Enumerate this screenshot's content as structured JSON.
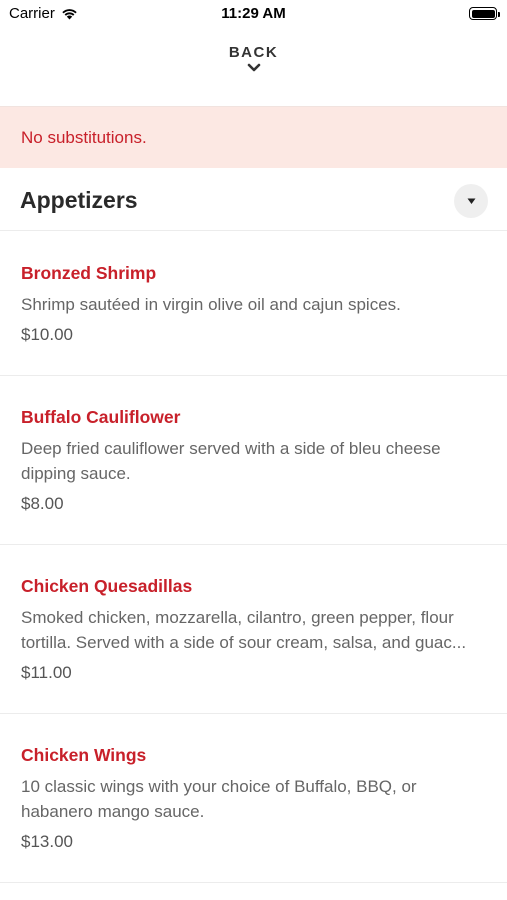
{
  "status_bar": {
    "carrier": "Carrier",
    "time": "11:29 AM",
    "wifi_icon": "wifi-icon",
    "battery_icon": "battery-icon"
  },
  "nav": {
    "back_label": "BACK",
    "back_icon": "chevron-down-icon"
  },
  "notice": {
    "text": "No substitutions.",
    "background": "#fce8e3",
    "text_color": "#c8202a"
  },
  "section": {
    "title": "Appetizers",
    "toggle_icon": "caret-down-icon"
  },
  "accent_color": "#c8202a",
  "items": [
    {
      "name": "Bronzed Shrimp",
      "description": "Shrimp sautéed in virgin olive oil and cajun spices.",
      "price": "$10.00"
    },
    {
      "name": "Buffalo Cauliflower",
      "description": "Deep fried cauliflower served with a side of bleu cheese\ndipping sauce.",
      "price": "$8.00"
    },
    {
      "name": "Chicken Quesadillas",
      "description": "Smoked chicken, mozzarella, cilantro, green pepper, flour\ntortilla. Served with a side of sour cream, salsa, and guac...",
      "price": "$11.00"
    },
    {
      "name": "Chicken Wings",
      "description": "10 classic wings with your choice of Buffalo, BBQ, or\nhabanero mango sauce.",
      "price": "$13.00"
    }
  ]
}
